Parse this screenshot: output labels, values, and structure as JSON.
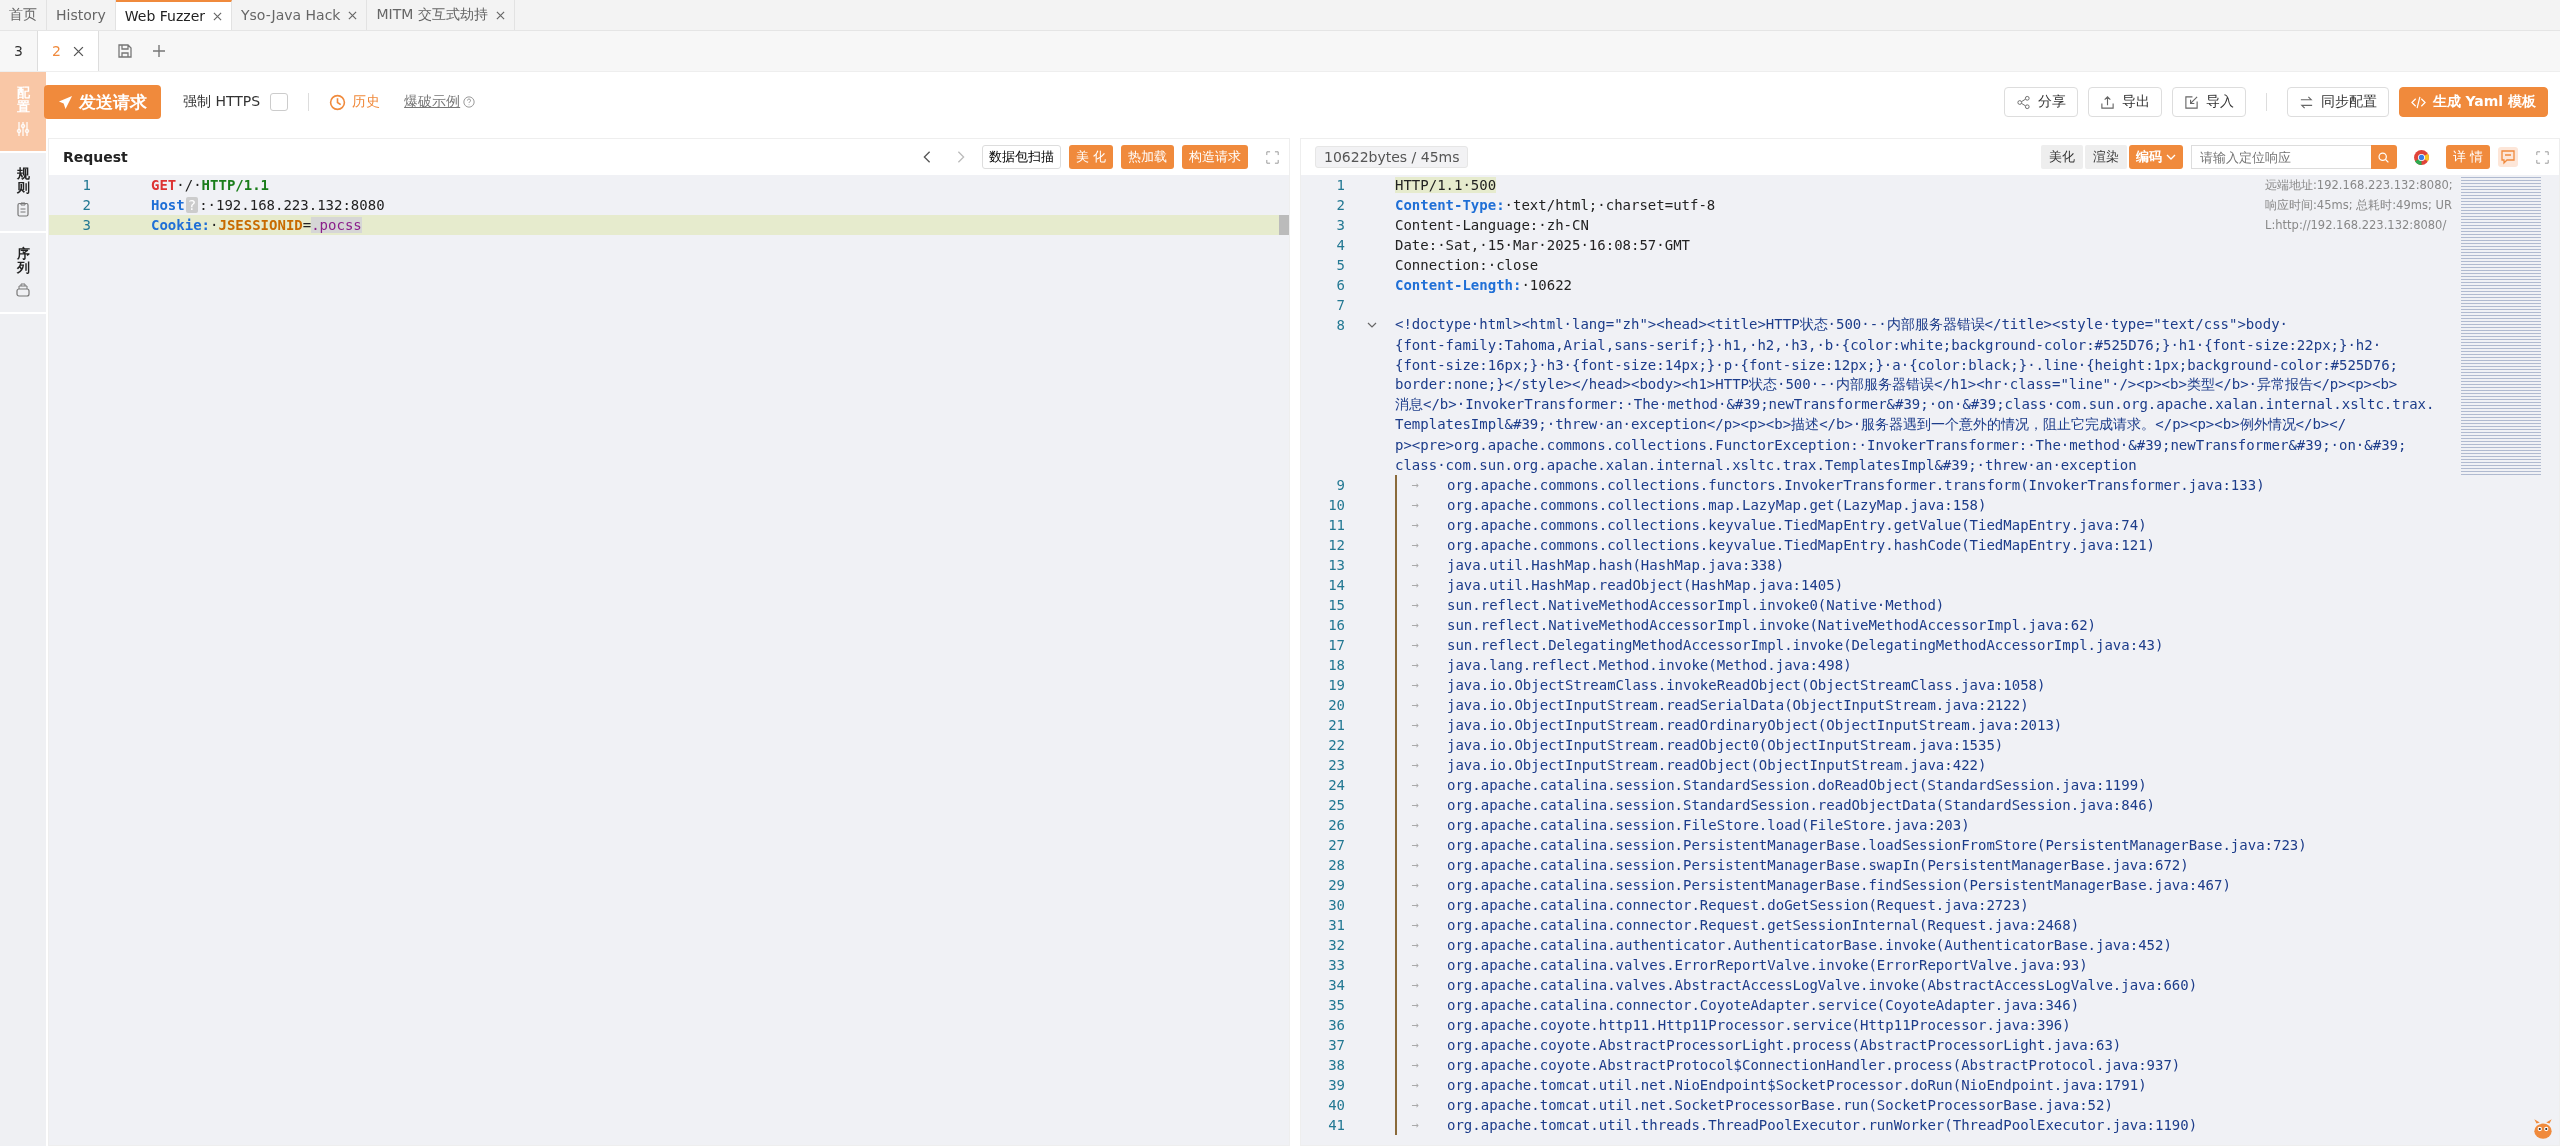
{
  "top_tabs": [
    {
      "label": "首页",
      "selected": false,
      "closable": false
    },
    {
      "label": "History",
      "selected": false,
      "closable": false
    },
    {
      "label": "Web Fuzzer",
      "selected": true,
      "closable": true
    },
    {
      "label": "Yso-Java Hack",
      "selected": false,
      "closable": true
    },
    {
      "label": "MITM 交互式劫持",
      "selected": false,
      "closable": true
    }
  ],
  "sub_tabs": [
    {
      "label": "3",
      "selected": false
    },
    {
      "label": "2",
      "selected": true
    }
  ],
  "side_tabs": [
    {
      "label": "配置",
      "selected": true
    },
    {
      "label": "规则",
      "selected": false
    },
    {
      "label": "序列",
      "selected": false
    }
  ],
  "toolbar": {
    "send": "发送请求",
    "force_https": {
      "label": "强制 HTTPS",
      "checked": false
    },
    "history": "历史",
    "example": "爆破示例",
    "actions": [
      {
        "label": "分享",
        "primary": false
      },
      {
        "label": "导出",
        "primary": false
      },
      {
        "label": "导入",
        "primary": false
      },
      {
        "label": "同步配置",
        "primary": false
      },
      {
        "label": "生成 Yaml 模板",
        "primary": true
      }
    ]
  },
  "request": {
    "title": "Request",
    "scan": "数据包扫描",
    "buttons": [
      "美 化",
      "热加载",
      "构造请求"
    ],
    "lines": [
      {
        "number": "1",
        "current": false,
        "tokens": [
          {
            "text": "GET",
            "kind": "method"
          },
          {
            "text": "·/·",
            "kind": "plain"
          },
          {
            "text": "HTTP/1.1",
            "kind": "version"
          }
        ]
      },
      {
        "number": "2",
        "current": false,
        "tokens": [
          {
            "text": "Host",
            "kind": "header"
          },
          {
            "text": "?",
            "kind": "hint"
          },
          {
            "text": ":·192.168.223.132:8080",
            "kind": "plain"
          }
        ]
      },
      {
        "number": "3",
        "current": true,
        "tokens": [
          {
            "text": "Cookie:",
            "kind": "header"
          },
          {
            "text": "·",
            "kind": "plain"
          },
          {
            "text": "JSESSIONID",
            "kind": "cookie"
          },
          {
            "text": "=",
            "kind": "plain"
          },
          {
            "text": ".pocss",
            "kind": "mark"
          }
        ]
      }
    ]
  },
  "response": {
    "stats": "10622bytes / 45ms",
    "view_buttons": [
      "美化",
      "渲染"
    ],
    "encoding": "编码",
    "search": {
      "placeholder": "请输入定位响应"
    },
    "details": "详 情",
    "info": "远端地址:192.168.223.132:8080; 响应时间:45ms; 总耗时:49ms; URL:http://192.168.223.132:8080/",
    "lines": [
      {
        "number": "1",
        "kind": "status",
        "current": true,
        "text": "HTTP/1.1·500"
      },
      {
        "number": "2",
        "kind": "header",
        "bold": true,
        "key": "Content-Type:",
        "value": "·text/html;·charset=utf-8"
      },
      {
        "number": "3",
        "kind": "header",
        "bold": false,
        "key": "Content-Language:",
        "value": "·zh-CN"
      },
      {
        "number": "4",
        "kind": "header",
        "bold": false,
        "key": "Date:",
        "value": "·Sat,·15·Mar·2025·16:08:57·GMT"
      },
      {
        "number": "5",
        "kind": "header",
        "bold": false,
        "key": "Connection:",
        "value": "·close"
      },
      {
        "number": "6",
        "kind": "header",
        "bold": true,
        "key": "Content-Length:",
        "value": "·10622"
      },
      {
        "number": "7",
        "kind": "blank"
      },
      {
        "number": "8",
        "kind": "html",
        "expanded": true,
        "rows": [
          "<!doctype·html><html·lang=\"zh\"><head><title>HTTP状态·500·-·内部服务器错误</title><style·type=\"text/css\">body·",
          "{font-family:Tahoma,Arial,sans-serif;}·h1,·h2,·h3,·b·{color:white;background-color:#525D76;}·h1·{font-size:22px;}·h2·",
          "{font-size:16px;}·h3·{font-size:14px;}·p·{font-size:12px;}·a·{color:black;}·.line·{height:1px;background-color:#525D76;",
          "border:none;}</style></head><body><h1>HTTP状态·500·-·内部服务器错误</h1><hr·class=\"line\"·/><p><b>类型</b>·异常报告</p><p><b>",
          "消息</b>·InvokerTransformer:·The·method·&#39;newTransformer&#39;·on·&#39;class·com.sun.org.apache.xalan.internal.xsltc.trax.",
          "TemplatesImpl&#39;·threw·an·exception</p><p><b>描述</b>·服务器遇到一个意外的情况，阻止它完成请求。</p><p><b>例外情况</b></",
          "p><pre>org.apache.commons.collections.FunctorException:·InvokerTransformer:·The·method·&#39;newTransformer&#39;·on·&#39;",
          "class·com.sun.org.apache.xalan.internal.xsltc.trax.TemplatesImpl&#39;·threw·an·exception"
        ]
      },
      {
        "number": "9",
        "kind": "trace",
        "tab": "→",
        "text": "org.apache.commons.collections.functors.InvokerTransformer.transform(InvokerTransformer.java:133)"
      },
      {
        "number": "10",
        "kind": "trace",
        "tab": "→",
        "text": "org.apache.commons.collections.map.LazyMap.get(LazyMap.java:158)"
      },
      {
        "number": "11",
        "kind": "trace",
        "tab": "→",
        "text": "org.apache.commons.collections.keyvalue.TiedMapEntry.getValue(TiedMapEntry.java:74)"
      },
      {
        "number": "12",
        "kind": "trace",
        "tab": "→",
        "text": "org.apache.commons.collections.keyvalue.TiedMapEntry.hashCode(TiedMapEntry.java:121)"
      },
      {
        "number": "13",
        "kind": "trace",
        "tab": "→",
        "text": "java.util.HashMap.hash(HashMap.java:338)"
      },
      {
        "number": "14",
        "kind": "trace",
        "tab": "→",
        "text": "java.util.HashMap.readObject(HashMap.java:1405)"
      },
      {
        "number": "15",
        "kind": "trace",
        "tab": "→",
        "text": "sun.reflect.NativeMethodAccessorImpl.invoke0(Native·Method)"
      },
      {
        "number": "16",
        "kind": "trace",
        "tab": "→",
        "text": "sun.reflect.NativeMethodAccessorImpl.invoke(NativeMethodAccessorImpl.java:62)"
      },
      {
        "number": "17",
        "kind": "trace",
        "tab": "→",
        "text": "sun.reflect.DelegatingMethodAccessorImpl.invoke(DelegatingMethodAccessorImpl.java:43)"
      },
      {
        "number": "18",
        "kind": "trace",
        "tab": "→",
        "text": "java.lang.reflect.Method.invoke(Method.java:498)"
      },
      {
        "number": "19",
        "kind": "trace",
        "tab": "→",
        "text": "java.io.ObjectStreamClass.invokeReadObject(ObjectStreamClass.java:1058)"
      },
      {
        "number": "20",
        "kind": "trace",
        "tab": "→",
        "text": "java.io.ObjectInputStream.readSerialData(ObjectInputStream.java:2122)"
      },
      {
        "number": "21",
        "kind": "trace",
        "tab": "→",
        "text": "java.io.ObjectInputStream.readOrdinaryObject(ObjectInputStream.java:2013)"
      },
      {
        "number": "22",
        "kind": "trace",
        "tab": "→",
        "text": "java.io.ObjectInputStream.readObject0(ObjectInputStream.java:1535)"
      },
      {
        "number": "23",
        "kind": "trace",
        "tab": "→",
        "text": "java.io.ObjectInputStream.readObject(ObjectInputStream.java:422)"
      },
      {
        "number": "24",
        "kind": "trace",
        "tab": "→",
        "text": "org.apache.catalina.session.StandardSession.doReadObject(StandardSession.java:1199)"
      },
      {
        "number": "25",
        "kind": "trace",
        "tab": "→",
        "text": "org.apache.catalina.session.StandardSession.readObjectData(StandardSession.java:846)"
      },
      {
        "number": "26",
        "kind": "trace",
        "tab": "→",
        "text": "org.apache.catalina.session.FileStore.load(FileStore.java:203)"
      },
      {
        "number": "27",
        "kind": "trace",
        "tab": "→",
        "text": "org.apache.catalina.session.PersistentManagerBase.loadSessionFromStore(PersistentManagerBase.java:723)"
      },
      {
        "number": "28",
        "kind": "trace",
        "tab": "→",
        "text": "org.apache.catalina.session.PersistentManagerBase.swapIn(PersistentManagerBase.java:672)"
      },
      {
        "number": "29",
        "kind": "trace",
        "tab": "→",
        "text": "org.apache.catalina.session.PersistentManagerBase.findSession(PersistentManagerBase.java:467)"
      },
      {
        "number": "30",
        "kind": "trace",
        "tab": "→",
        "text": "org.apache.catalina.connector.Request.doGetSession(Request.java:2723)"
      },
      {
        "number": "31",
        "kind": "trace",
        "tab": "→",
        "text": "org.apache.catalina.connector.Request.getSessionInternal(Request.java:2468)"
      },
      {
        "number": "32",
        "kind": "trace",
        "tab": "→",
        "text": "org.apache.catalina.authenticator.AuthenticatorBase.invoke(AuthenticatorBase.java:452)"
      },
      {
        "number": "33",
        "kind": "trace",
        "tab": "→",
        "text": "org.apache.catalina.valves.ErrorReportValve.invoke(ErrorReportValve.java:93)"
      },
      {
        "number": "34",
        "kind": "trace",
        "tab": "→",
        "text": "org.apache.catalina.valves.AbstractAccessLogValve.invoke(AbstractAccessLogValve.java:660)"
      },
      {
        "number": "35",
        "kind": "trace",
        "tab": "→",
        "text": "org.apache.catalina.connector.CoyoteAdapter.service(CoyoteAdapter.java:346)"
      },
      {
        "number": "36",
        "kind": "trace",
        "tab": "→",
        "text": "org.apache.coyote.http11.Http11Processor.service(Http11Processor.java:396)"
      },
      {
        "number": "37",
        "kind": "trace",
        "tab": "→",
        "text": "org.apache.coyote.AbstractProcessorLight.process(AbstractProcessorLight.java:63)"
      },
      {
        "number": "38",
        "kind": "trace",
        "tab": "→",
        "text": "org.apache.coyote.AbstractProtocol$ConnectionHandler.process(AbstractProtocol.java:937)"
      },
      {
        "number": "39",
        "kind": "trace",
        "tab": "→",
        "text": "org.apache.tomcat.util.net.NioEndpoint$SocketProcessor.doRun(NioEndpoint.java:1791)"
      },
      {
        "number": "40",
        "kind": "trace",
        "tab": "→",
        "text": "org.apache.tomcat.util.net.SocketProcessorBase.run(SocketProcessorBase.java:52)"
      },
      {
        "number": "41",
        "kind": "trace",
        "tab": "→",
        "text": "org.apache.tomcat.util.threads.ThreadPoolExecutor.runWorker(ThreadPoolExecutor.java:1190)"
      }
    ]
  }
}
